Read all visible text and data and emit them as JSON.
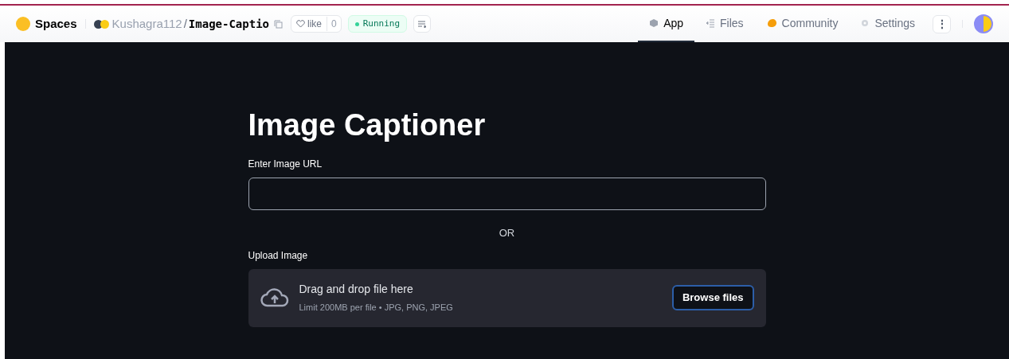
{
  "header": {
    "brand": "Spaces",
    "owner": "Kushagra112",
    "separator": "/",
    "repo": "Image-Captio",
    "like": {
      "label": "like",
      "count": "0"
    },
    "status": "Running",
    "tabs": [
      {
        "label": "App",
        "selected": true
      },
      {
        "label": "Files",
        "selected": false
      },
      {
        "label": "Community",
        "selected": false
      },
      {
        "label": "Settings",
        "selected": false
      }
    ],
    "more": "⋮"
  },
  "app": {
    "title": "Image Captioner",
    "url_label": "Enter Image URL",
    "or": "OR",
    "upload_label": "Upload Image",
    "dropzone": {
      "title": "Drag and drop file here",
      "hint": "Limit 200MB per file • JPG, PNG, JPEG",
      "button": "Browse files"
    }
  }
}
